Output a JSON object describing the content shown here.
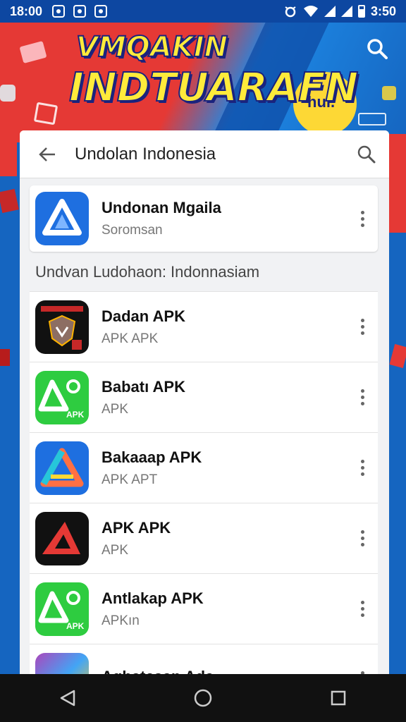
{
  "status_bar": {
    "time": "18:00",
    "right_time": "3:50"
  },
  "banner": {
    "title_line1": "VMQAKIN",
    "title_line2": "INDTUARAFN",
    "badge_text": "hul."
  },
  "search": {
    "query": "Undolan Indonesia"
  },
  "top_result": {
    "name": "Undonan Mgaila",
    "subtitle": "Soromsan"
  },
  "section_title": "Undvan Ludohaon: Indonnasiam",
  "apps": [
    {
      "name": "Dadan APK",
      "subtitle": "APK APK",
      "icon": "shield-icon"
    },
    {
      "name": "Babatı APK",
      "subtitle": "APK",
      "icon": "apk-green-icon"
    },
    {
      "name": "Bakaaap APK",
      "subtitle": "APK APT",
      "icon": "rainbow-triangle-icon"
    },
    {
      "name": "APK APK",
      "subtitle": "APK",
      "icon": "red-triangle-icon"
    },
    {
      "name": "Antlakap APK",
      "subtitle": "APKın",
      "icon": "apk-green-icon"
    },
    {
      "name": "Aghatesan Ada",
      "subtitle": "",
      "icon": "gradient-icon"
    }
  ],
  "colors": {
    "banner_red": "#e53935",
    "banner_blue": "#1565c0",
    "title_yellow": "#ffeb3b",
    "apk_green": "#2ecc40"
  }
}
